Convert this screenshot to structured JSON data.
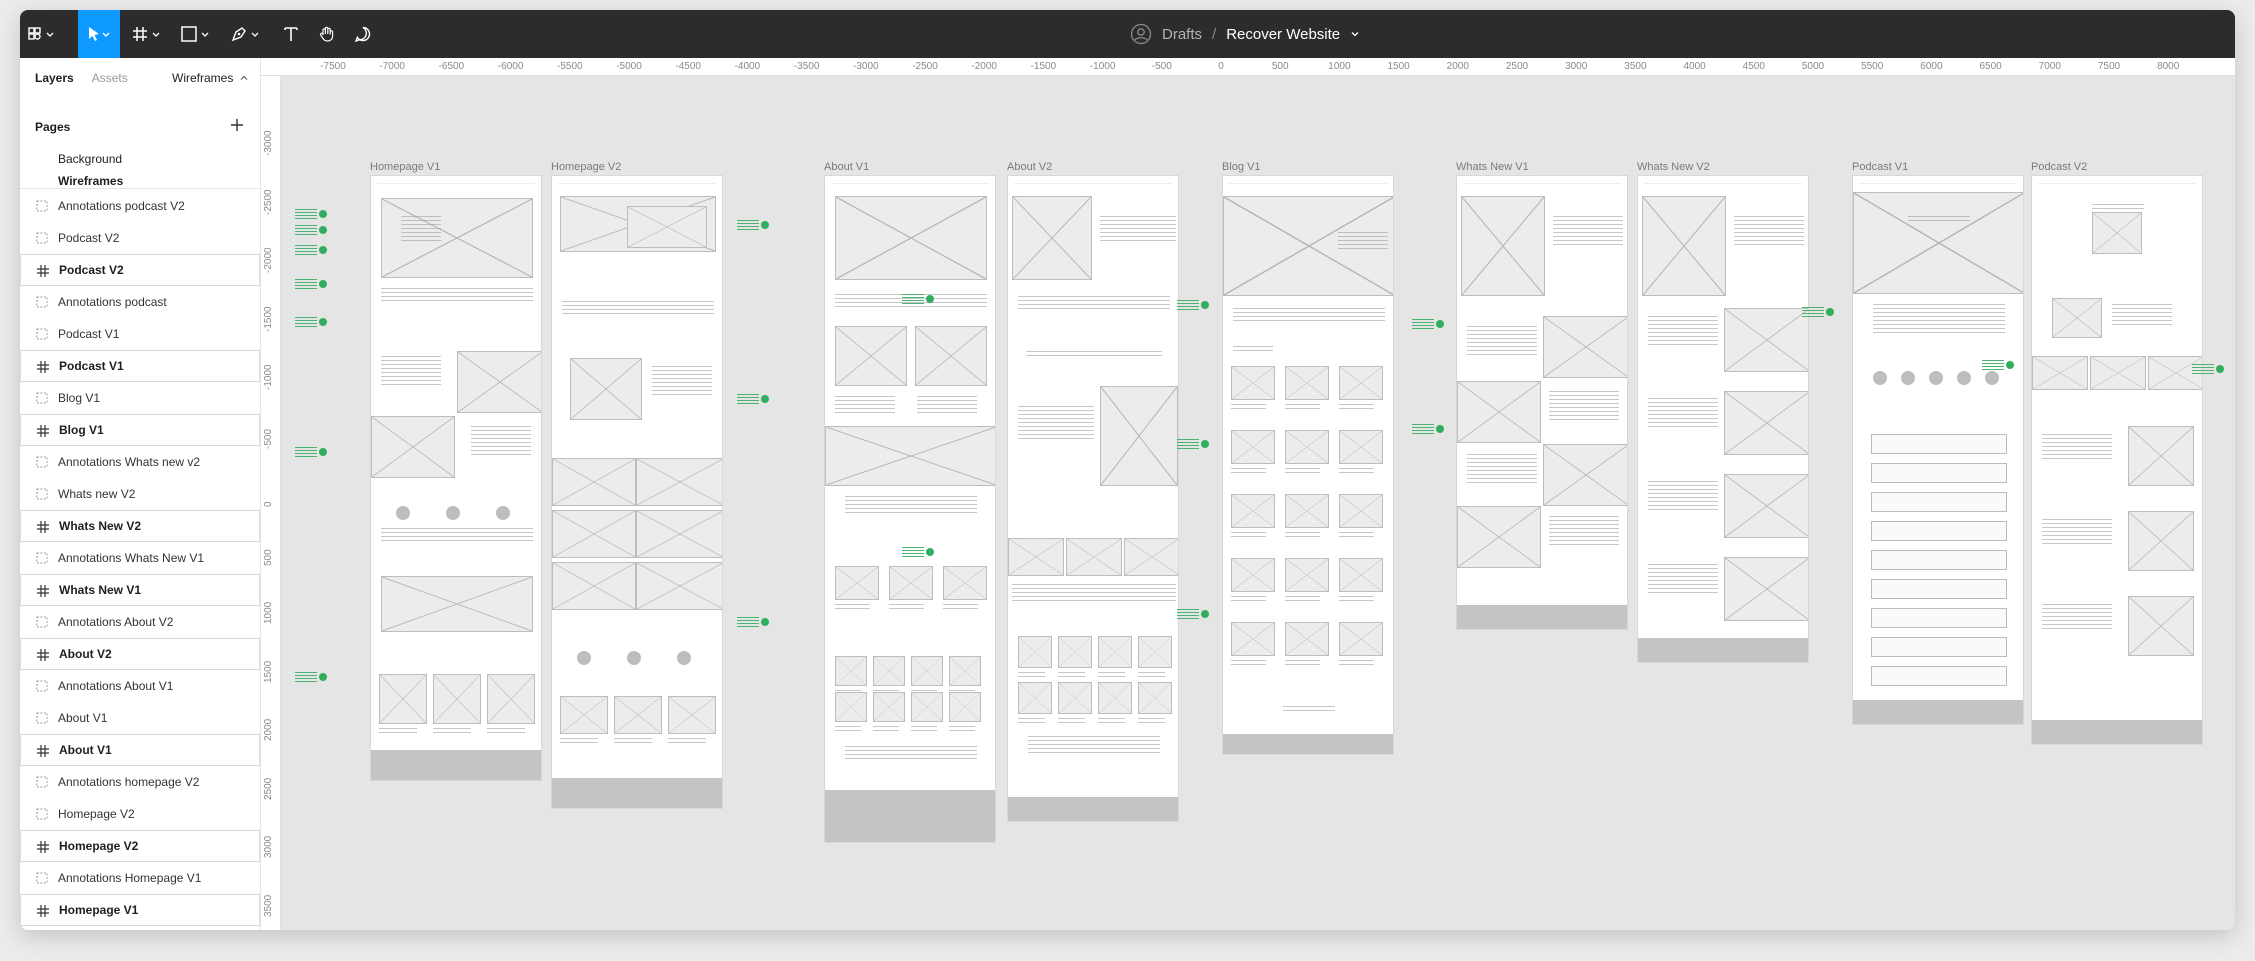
{
  "toolbar": {
    "project": {
      "drafts": "Drafts",
      "separator": "/",
      "name": "Recover Website"
    },
    "tools": [
      "main-menu-icon",
      "move-icon",
      "frame-icon",
      "shape-icon",
      "pen-icon",
      "text-icon",
      "hand-icon",
      "comment-icon"
    ],
    "accent": "#0d99ff",
    "bar_color": "#2c2c2c"
  },
  "left_panel": {
    "tabs": {
      "layers": "Layers",
      "assets": "Assets",
      "page_switcher": "Wireframes"
    },
    "pages_header": "Pages",
    "pages": [
      "Background",
      "Wireframes"
    ],
    "layers": [
      {
        "name": "Annotations podcast V2",
        "kind": "group"
      },
      {
        "name": "Podcast V2",
        "kind": "group"
      },
      {
        "name": "Podcast V2",
        "kind": "frame"
      },
      {
        "name": "Annotations podcast",
        "kind": "group"
      },
      {
        "name": "Podcast V1",
        "kind": "group"
      },
      {
        "name": "Podcast V1",
        "kind": "frame"
      },
      {
        "name": "Blog V1",
        "kind": "group"
      },
      {
        "name": "Blog V1",
        "kind": "frame"
      },
      {
        "name": "Annotations Whats new v2",
        "kind": "group"
      },
      {
        "name": "Whats new V2",
        "kind": "group"
      },
      {
        "name": "Whats New V2",
        "kind": "frame"
      },
      {
        "name": "Annotations Whats New V1",
        "kind": "group"
      },
      {
        "name": "Whats New V1",
        "kind": "frame"
      },
      {
        "name": "Annotations About V2",
        "kind": "group"
      },
      {
        "name": "About V2",
        "kind": "frame"
      },
      {
        "name": "Annotations About V1",
        "kind": "group"
      },
      {
        "name": "About V1",
        "kind": "group"
      },
      {
        "name": "About V1",
        "kind": "frame"
      },
      {
        "name": "Annotations homepage V2",
        "kind": "group"
      },
      {
        "name": "Homepage V2",
        "kind": "group"
      },
      {
        "name": "Homepage V2",
        "kind": "frame"
      },
      {
        "name": "Annotations Homepage V1",
        "kind": "group"
      },
      {
        "name": "Homepage V1",
        "kind": "frame"
      }
    ]
  },
  "canvas": {
    "ruler_top": [
      "-7500",
      "-7000",
      "-6500",
      "-6000",
      "-5500",
      "-5000",
      "-4500",
      "-4000",
      "-3500",
      "-3000",
      "-2500",
      "-2000",
      "-1500",
      "-1000",
      "-500",
      "0",
      "500",
      "1000",
      "1500",
      "2000",
      "2500",
      "3000",
      "3500",
      "4000",
      "4500",
      "5000",
      "5500",
      "6000",
      "6500",
      "7000",
      "7500",
      "8000"
    ],
    "ruler_left": [
      "-3000",
      "-2500",
      "-2000",
      "-1500",
      "-1000",
      "-500",
      "0",
      "500",
      "1000",
      "1500",
      "2000",
      "2500",
      "3000",
      "3500"
    ],
    "frames": [
      {
        "label": "Homepage V1"
      },
      {
        "label": "Homepage V2"
      },
      {
        "label": "About V1"
      },
      {
        "label": "About V2"
      },
      {
        "label": "Blog V1"
      },
      {
        "label": "Whats New V1"
      },
      {
        "label": "Whats New V2"
      },
      {
        "label": "Podcast V1"
      },
      {
        "label": "Podcast V2"
      }
    ],
    "annotation_color": "#2fae5e"
  }
}
